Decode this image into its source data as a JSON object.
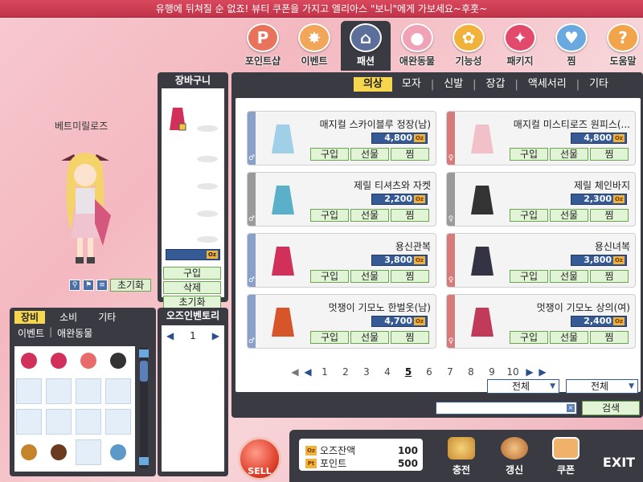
{
  "banner": "유행에 뒤쳐질 순 없죠! 뷰티 쿠폰을 가지고 엘리아스 \"보니\"에게 가보세요~후훗~",
  "categories": [
    {
      "label": "포인트샵",
      "icon": "p-icon",
      "glyph": "P",
      "color": "#e8735a"
    },
    {
      "label": "이벤트",
      "icon": "event-icon",
      "glyph": "✸",
      "color": "#f1a65a"
    },
    {
      "label": "패션",
      "icon": "hanger-icon",
      "glyph": "⌂",
      "color": "#5b6f9a",
      "active": true
    },
    {
      "label": "애완동물",
      "icon": "pig-icon",
      "glyph": "●",
      "color": "#f0a3b7"
    },
    {
      "label": "기능성",
      "icon": "gear-icon",
      "glyph": "✿",
      "color": "#f0b23a"
    },
    {
      "label": "패키지",
      "icon": "gift-icon",
      "glyph": "✦",
      "color": "#e2496a"
    },
    {
      "label": "찜",
      "icon": "cart-icon",
      "glyph": "♥",
      "color": "#6aa9e0"
    },
    {
      "label": "도움말",
      "icon": "help-icon",
      "glyph": "?",
      "color": "#f2a44a"
    }
  ],
  "character": {
    "name": "베트미릴로즈",
    "reset_label": "초기화"
  },
  "cart": {
    "title": "장바구니",
    "buy": "구입",
    "delete": "삭제",
    "reset": "초기화",
    "oz_label": "Oz"
  },
  "inventory": {
    "tabs": [
      "장비",
      "소비",
      "기타"
    ],
    "subtabs": [
      "이벤트",
      "애완동물"
    ]
  },
  "oz_inventory": {
    "title": "오즈인벤토리",
    "page": "1"
  },
  "shop": {
    "subtabs": [
      "의상",
      "모자",
      "신발",
      "장갑",
      "액세서리",
      "기타"
    ],
    "items": [
      {
        "name": "매지컬 스카이블루 정장(남)",
        "price": "4,800",
        "gender": "male",
        "stripe": "#8aa0c8"
      },
      {
        "name": "매지컬 미스티로즈 원피스(...",
        "price": "4,800",
        "gender": "female",
        "stripe": "#d67b7b"
      },
      {
        "name": "제릴 티셔츠와 자켓",
        "price": "2,200",
        "gender": "male",
        "stripe": "#9a9a9a"
      },
      {
        "name": "제릴 체인바지",
        "price": "2,300",
        "gender": "female",
        "stripe": "#9a9a9a"
      },
      {
        "name": "용신관복",
        "price": "3,800",
        "gender": "male",
        "stripe": "#8aa0c8"
      },
      {
        "name": "용신녀복",
        "price": "3,800",
        "gender": "female",
        "stripe": "#d67b7b"
      },
      {
        "name": "멋쟁이 기모노 한벌옷(남)",
        "price": "4,700",
        "gender": "male",
        "stripe": "#8aa0c8"
      },
      {
        "name": "멋쟁이 기모노 상의(여)",
        "price": "2,400",
        "gender": "female",
        "stripe": "#d67b7b"
      }
    ],
    "buy": "구입",
    "gift": "선물",
    "wish": "찜",
    "oz": "Oz",
    "pages": [
      "1",
      "2",
      "3",
      "4",
      "5",
      "6",
      "7",
      "8",
      "9",
      "10"
    ],
    "current_page": "5",
    "filter1": "전체",
    "filter2": "전체",
    "search_placeholder": "",
    "search_button": "검색"
  },
  "balance": {
    "oz_label": "오즈잔액",
    "oz_value": "100",
    "point_label": "포인트",
    "point_value": "500"
  },
  "bottom": {
    "sell": "SELL",
    "charge": "충전",
    "refresh": "갱신",
    "coupon": "쿠폰",
    "exit": "EXIT"
  }
}
